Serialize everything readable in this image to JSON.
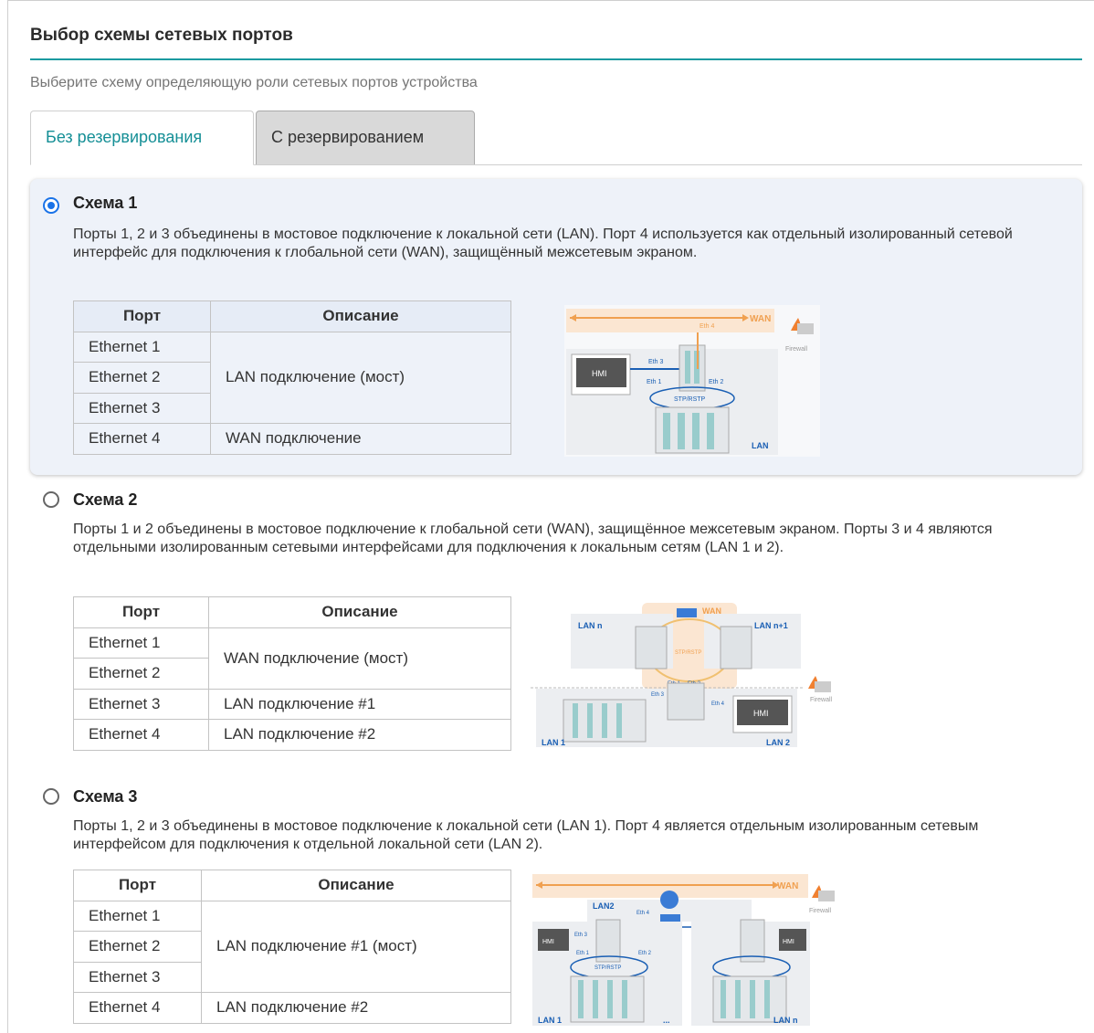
{
  "page": {
    "title": "Выбор схемы сетевых портов",
    "subtitle": "Выберите схему определяющую роли сетевых портов устройства"
  },
  "tabs": [
    {
      "label": "Без резервирования",
      "active": true
    },
    {
      "label": "С резервированием",
      "active": false
    }
  ],
  "colors": {
    "accent": "#158f96",
    "radio": "#1a73e8",
    "wan": "#f0a050",
    "eth": "#1a5fb4"
  },
  "table_headers": {
    "port": "Порт",
    "description": "Описание"
  },
  "schemes": [
    {
      "name": "Схема 1",
      "selected": true,
      "description": "Порты 1, 2 и 3 объединены в мостовое подключение к локальной сети (LAN). Порт 4 используется как отдельный изолированный сетевой интерфейс для подключения к глобальной сети (WAN), защищённый межсетевым экраном.",
      "ports": [
        "Ethernet 1",
        "Ethernet 2",
        "Ethernet 3",
        "Ethernet 4"
      ],
      "descriptions": [
        "LAN подключение (мост)",
        "WAN подключение"
      ],
      "diagram_labels": {
        "wan": "WAN",
        "eth4": "Eth 4",
        "firewall": "Firewall",
        "eth3": "Eth 3",
        "hmi": "HMI",
        "eth1": "Eth 1",
        "eth2": "Eth 2",
        "stp": "STP/RSTP",
        "lan": "LAN"
      }
    },
    {
      "name": "Схема 2",
      "selected": false,
      "description": "Порты 1 и 2 объединены в мостовое подключение к глобальной сети (WAN), защищённое межсетевым экраном. Порты 3 и 4 являются отдельными изолированным сетевыми интерфейсами для подключения к локальным сетям (LAN 1 и 2).",
      "ports": [
        "Ethernet 1",
        "Ethernet 2",
        "Ethernet 3",
        "Ethernet 4"
      ],
      "descriptions": [
        "WAN подключение (мост)",
        "LAN подключение #1",
        "LAN подключение #2"
      ],
      "diagram_labels": {
        "wan": "WAN",
        "lann": "LAN n",
        "lann1": "LAN n+1",
        "stp": "STP/RSTP",
        "eth1": "Eth 1",
        "eth2": "Eth 2",
        "eth3": "Eth 3",
        "eth4": "Eth 4",
        "firewall": "Firewall",
        "hmi": "HMI",
        "lan1": "LAN 1",
        "lan2": "LAN 2"
      }
    },
    {
      "name": "Схема 3",
      "selected": false,
      "description": "Порты 1, 2 и 3 объединены в мостовое подключение к локальной сети (LAN 1). Порт 4 является отдельным изолированным сетевым интерфейсом для подключения к отдельной локальной сети (LAN 2).",
      "ports": [
        "Ethernet 1",
        "Ethernet 2",
        "Ethernet 3",
        "Ethernet 4"
      ],
      "descriptions": [
        "LAN подключение #1 (мост)",
        "LAN подключение #2"
      ],
      "diagram_labels": {
        "wan": "WAN",
        "lan2": "LAN2",
        "eth4": "Eth 4",
        "firewall": "Firewall",
        "eth3": "Eth 3",
        "hmi": "HMI",
        "eth1": "Eth 1",
        "eth2": "Eth 2",
        "stp": "STP/RSTP",
        "lan1": "LAN 1",
        "dots": "...",
        "lann": "LAN n"
      }
    }
  ]
}
